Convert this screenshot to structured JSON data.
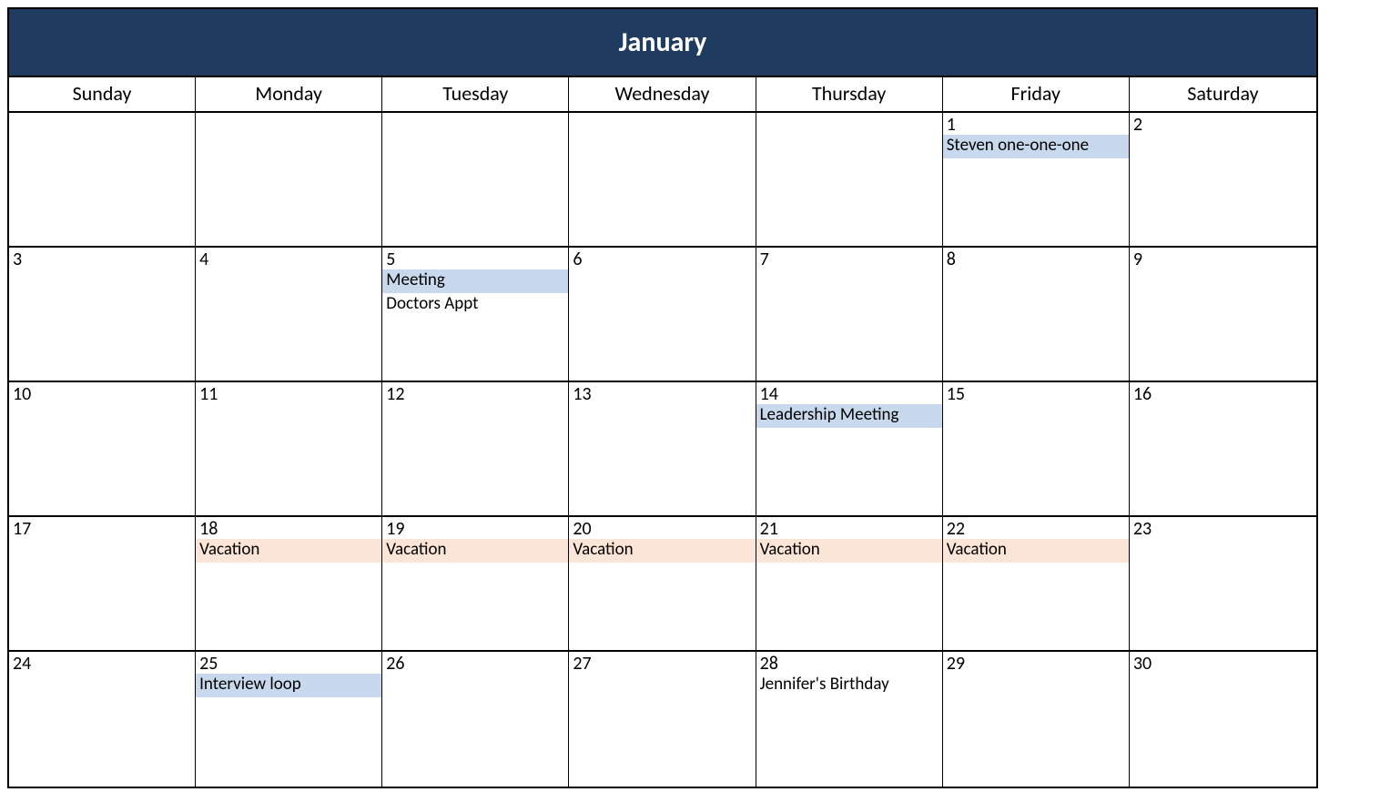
{
  "month_title": "January",
  "weekdays": [
    "Sunday",
    "Monday",
    "Tuesday",
    "Wednesday",
    "Thursday",
    "Friday",
    "Saturday"
  ],
  "event_colors": {
    "blue": "#c8d9ee",
    "peach": "#fbe5d6"
  },
  "weeks": [
    [
      {
        "day": "",
        "events": []
      },
      {
        "day": "",
        "events": []
      },
      {
        "day": "",
        "events": []
      },
      {
        "day": "",
        "events": []
      },
      {
        "day": "",
        "events": []
      },
      {
        "day": "1",
        "events": [
          {
            "label": "Steven one-one-one",
            "style": "blue"
          }
        ]
      },
      {
        "day": "2",
        "events": []
      }
    ],
    [
      {
        "day": "3",
        "events": []
      },
      {
        "day": "4",
        "events": []
      },
      {
        "day": "5",
        "events": [
          {
            "label": "Meeting",
            "style": "blue"
          },
          {
            "label": "Doctors Appt",
            "style": "plain"
          }
        ]
      },
      {
        "day": "6",
        "events": []
      },
      {
        "day": "7",
        "events": []
      },
      {
        "day": "8",
        "events": []
      },
      {
        "day": "9",
        "events": []
      }
    ],
    [
      {
        "day": "10",
        "events": []
      },
      {
        "day": "11",
        "events": []
      },
      {
        "day": "12",
        "events": []
      },
      {
        "day": "13",
        "events": []
      },
      {
        "day": "14",
        "events": [
          {
            "label": "Leadership Meeting",
            "style": "blue"
          }
        ]
      },
      {
        "day": "15",
        "events": []
      },
      {
        "day": "16",
        "events": []
      }
    ],
    [
      {
        "day": "17",
        "events": []
      },
      {
        "day": "18",
        "events": [
          {
            "label": "Vacation",
            "style": "peach"
          }
        ]
      },
      {
        "day": "19",
        "events": [
          {
            "label": "Vacation",
            "style": "peach"
          }
        ]
      },
      {
        "day": "20",
        "events": [
          {
            "label": "Vacation",
            "style": "peach"
          }
        ]
      },
      {
        "day": "21",
        "events": [
          {
            "label": "Vacation",
            "style": "peach"
          }
        ]
      },
      {
        "day": "22",
        "events": [
          {
            "label": "Vacation",
            "style": "peach"
          }
        ]
      },
      {
        "day": "23",
        "events": []
      }
    ],
    [
      {
        "day": "24",
        "events": []
      },
      {
        "day": "25",
        "events": [
          {
            "label": "Interview loop",
            "style": "blue"
          }
        ]
      },
      {
        "day": "26",
        "events": []
      },
      {
        "day": "27",
        "events": []
      },
      {
        "day": "28",
        "events": [
          {
            "label": "Jennifer's Birthday",
            "style": "plain"
          }
        ]
      },
      {
        "day": "29",
        "events": []
      },
      {
        "day": "30",
        "events": []
      }
    ]
  ]
}
